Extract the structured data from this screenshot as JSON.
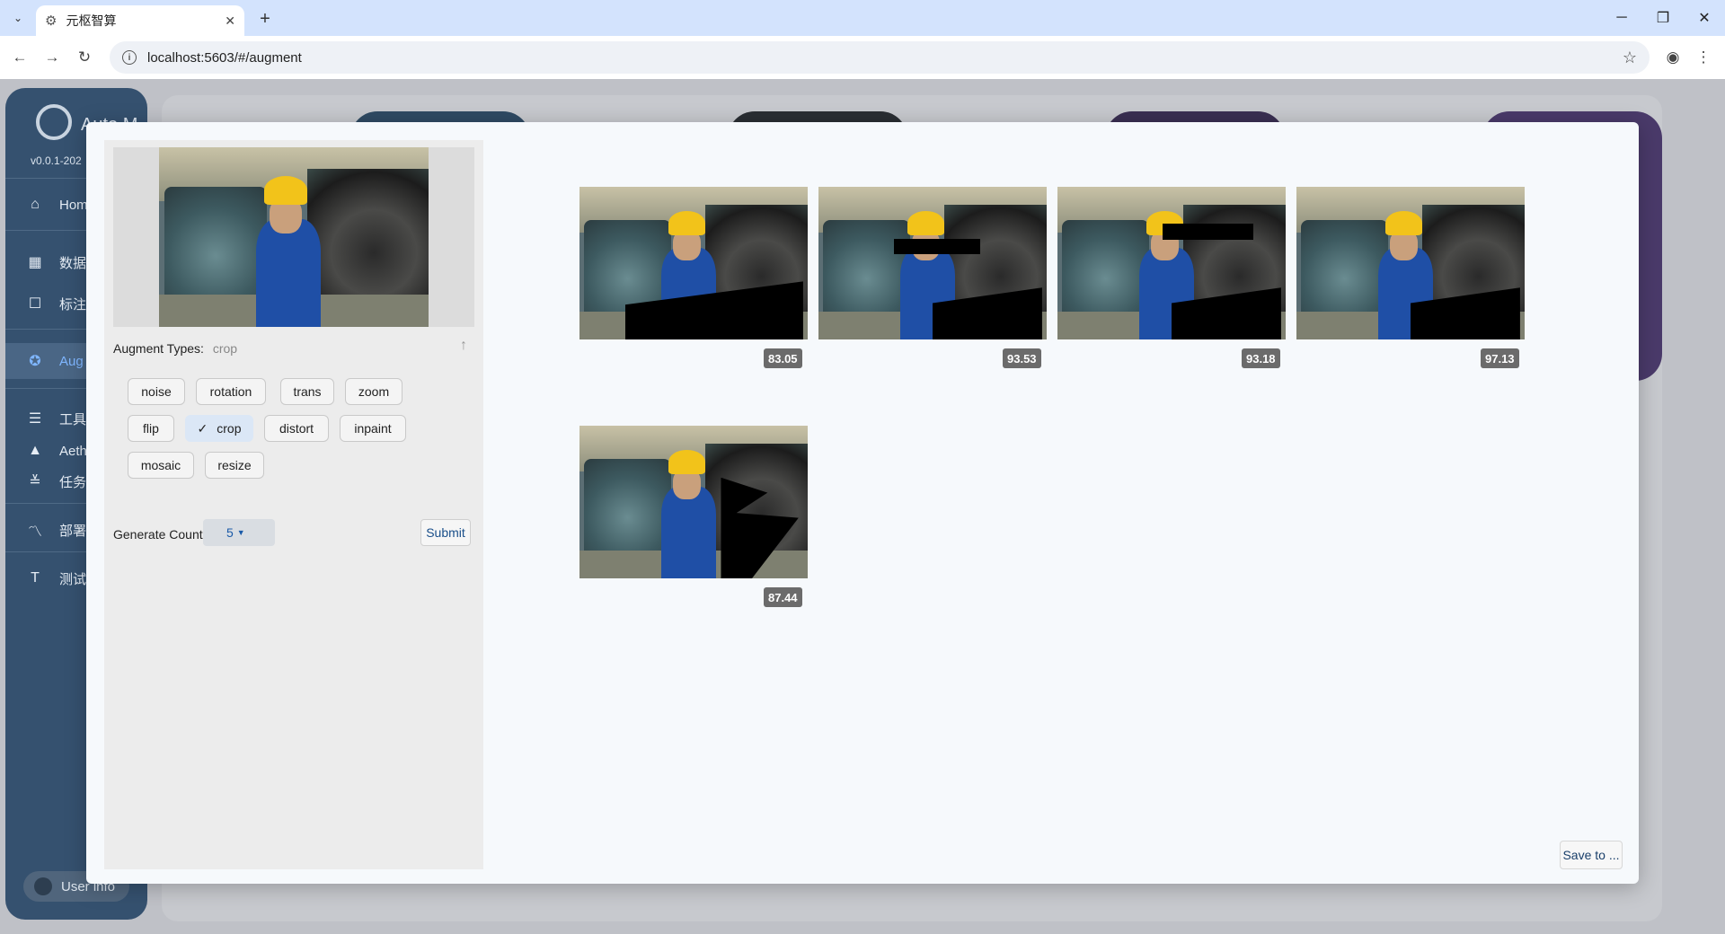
{
  "browser": {
    "tab_title": "元枢智算",
    "url": "localhost:5603/#/augment"
  },
  "sidebar": {
    "logo_text": "Auto M",
    "version": "v0.0.1-202",
    "items": [
      {
        "label": "Hom",
        "icon": "home-icon"
      },
      {
        "label": "数据",
        "icon": "grid-icon"
      },
      {
        "label": "标注",
        "icon": "square-icon"
      },
      {
        "label": "Aug",
        "icon": "augment-icon"
      },
      {
        "label": "工具",
        "icon": "list-icon"
      },
      {
        "label": "Aeth",
        "icon": "rocket-icon"
      },
      {
        "label": "任务",
        "icon": "task-icon"
      },
      {
        "label": "部署",
        "icon": "chart-icon"
      },
      {
        "label": "测试",
        "icon": "text-icon"
      }
    ],
    "user_info": "User info"
  },
  "dialog": {
    "augment_types_label": "Augment Types:",
    "augment_types_selected": "crop",
    "chips": [
      "noise",
      "rotation",
      "trans",
      "zoom",
      "flip",
      "crop",
      "distort",
      "inpaint",
      "mosaic",
      "resize"
    ],
    "checked_chip": "crop",
    "checkmark": "✓",
    "generate_count_label": "Generate Count:",
    "generate_count_value": "5",
    "submit_label": "Submit",
    "save_label": "Save to ...",
    "results": [
      {
        "score": "83.05"
      },
      {
        "score": "93.53"
      },
      {
        "score": "93.18"
      },
      {
        "score": "97.13"
      },
      {
        "score": "87.44"
      }
    ]
  },
  "colors": {
    "accent": "#1a5aa8",
    "sidebar_bg": "#35516f",
    "chip_checked": "#dbe7f6"
  }
}
